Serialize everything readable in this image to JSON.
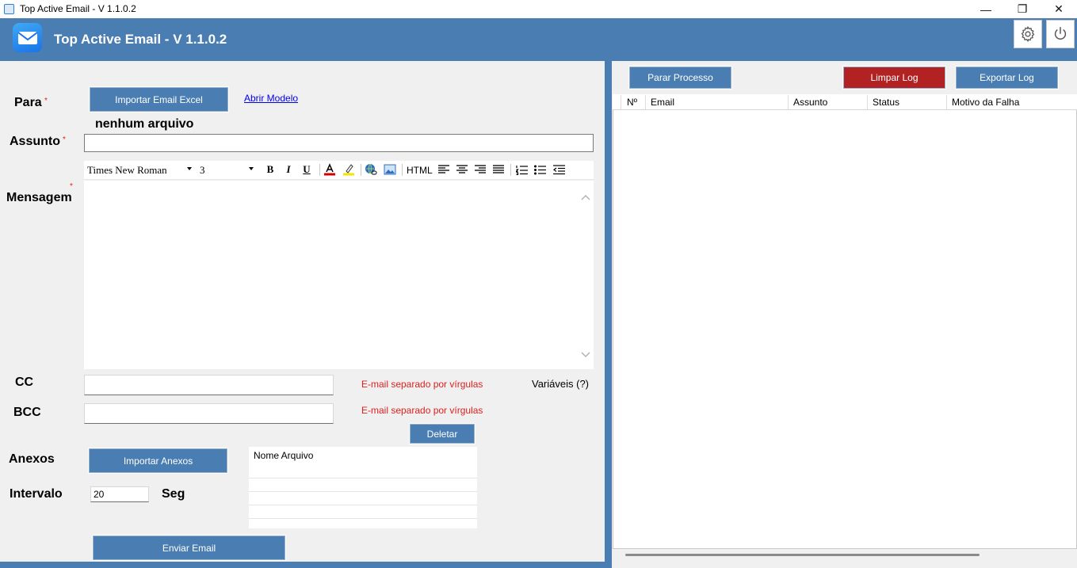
{
  "window": {
    "title": "Top Active Email - V 1.1.0.2",
    "controls": {
      "minimize": "—",
      "restore": "❐",
      "close": "✕"
    }
  },
  "header": {
    "title": "Top Active Email - V 1.1.0.2",
    "icons": {
      "logo": "email-icon",
      "settings": "gear-icon",
      "power": "power-icon"
    }
  },
  "form": {
    "para_label": "Para",
    "required_mark": "*",
    "import_excel_label": "Importar Email Excel",
    "open_template_label": "Abrir Modelo",
    "no_file_text": "nenhum arquivo",
    "assunto_label": "Assunto",
    "assunto_value": "",
    "mensagem_label": "Mensagem",
    "cc_label": "CC",
    "cc_value": "",
    "bcc_label": "BCC",
    "bcc_value": "",
    "comma_hint": "E-mail separado por vírgulas",
    "variables_label": "Variáveis (?)",
    "delete_label": "Deletar",
    "anexos_label": "Anexos",
    "import_attach_label": "Importar Anexos",
    "attach_column": "Nome Arquivo",
    "intervalo_label": "Intervalo",
    "intervalo_value": "20",
    "seg_label": "Seg",
    "send_label": "Enviar Email"
  },
  "editor": {
    "font_family": "Times New Roman",
    "font_size": "3",
    "html_label": "HTML",
    "tools": {
      "bold": "B",
      "italic": "I",
      "underline": "U"
    }
  },
  "log": {
    "stop_label": "Parar Processo",
    "clear_label": "Limpar Log",
    "export_label": "Exportar Log",
    "columns": [
      "Nº",
      "Email",
      "Assunto",
      "Status",
      "Motivo da Falha"
    ]
  },
  "colors": {
    "brand": "#4a7eb2",
    "danger": "#b22222",
    "hint": "#e02020"
  }
}
